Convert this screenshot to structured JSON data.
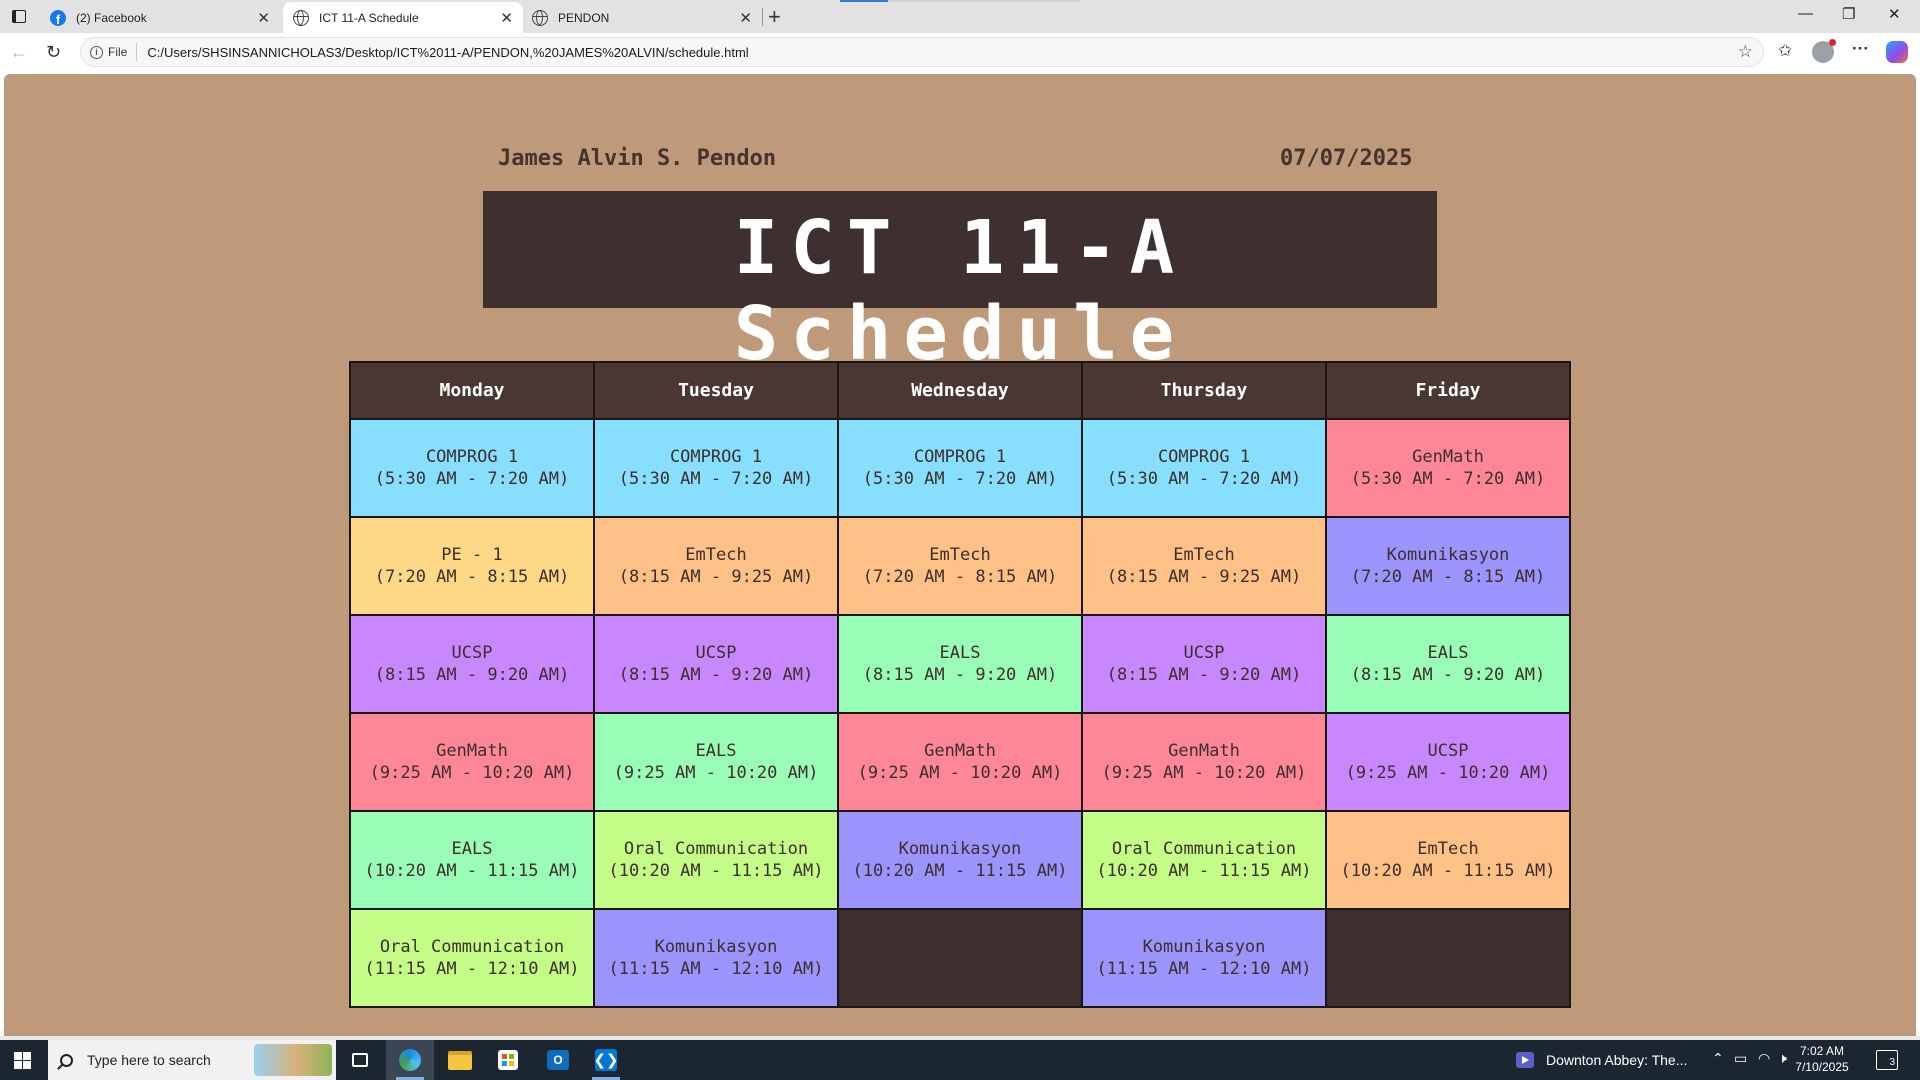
{
  "browser": {
    "tabs": [
      {
        "label": "(2) Facebook",
        "icon": "facebook-icon",
        "active": false
      },
      {
        "label": "ICT 11-A Schedule",
        "icon": "globe-icon",
        "active": true
      },
      {
        "label": "PENDON",
        "icon": "globe-icon",
        "active": false
      }
    ],
    "address": {
      "scheme_label": "File",
      "url": "C:/Users/SHSINSANNICHOLAS3/Desktop/ICT%2011-A/PENDON,%20JAMES%20ALVIN/schedule.html"
    }
  },
  "page": {
    "name": "James Alvin S. Pendon",
    "date": "07/07/2025",
    "title": "ICT 11-A Schedule",
    "colors": {
      "background": "#bf9a7a",
      "banner": "#3e3030",
      "header": "#4a3733",
      "COMPROG 1": "#87dffd",
      "GenMath": "#fd8796",
      "PE - 1": "#fdd987",
      "EmTech": "#fdc087",
      "Komunikasyon": "#9a94fc",
      "UCSP": "#c987fd",
      "EALS": "#9afdb7",
      "Oral Communication": "#c3fd87"
    },
    "days": [
      "Monday",
      "Tuesday",
      "Wednesday",
      "Thursday",
      "Friday"
    ],
    "rows": [
      [
        {
          "subject": "COMPROG 1",
          "time": "(5:30 AM - 7:20 AM)"
        },
        {
          "subject": "COMPROG 1",
          "time": "(5:30 AM - 7:20 AM)"
        },
        {
          "subject": "COMPROG 1",
          "time": "(5:30 AM - 7:20 AM)"
        },
        {
          "subject": "COMPROG 1",
          "time": "(5:30 AM - 7:20 AM)"
        },
        {
          "subject": "GenMath",
          "time": "(5:30 AM - 7:20 AM)"
        }
      ],
      [
        {
          "subject": "PE - 1",
          "time": "(7:20 AM - 8:15 AM)"
        },
        {
          "subject": "EmTech",
          "time": "(8:15 AM - 9:25 AM)"
        },
        {
          "subject": "EmTech",
          "time": "(7:20 AM - 8:15 AM)"
        },
        {
          "subject": "EmTech",
          "time": "(8:15 AM - 9:25 AM)"
        },
        {
          "subject": "Komunikasyon",
          "time": "(7:20 AM - 8:15 AM)"
        }
      ],
      [
        {
          "subject": "UCSP",
          "time": "(8:15 AM - 9:20 AM)"
        },
        {
          "subject": "UCSP",
          "time": "(8:15 AM - 9:20 AM)"
        },
        {
          "subject": "EALS",
          "time": "(8:15 AM - 9:20 AM)"
        },
        {
          "subject": "UCSP",
          "time": "(8:15 AM - 9:20 AM)"
        },
        {
          "subject": "EALS",
          "time": "(8:15 AM - 9:20 AM)"
        }
      ],
      [
        {
          "subject": "GenMath",
          "time": "(9:25 AM - 10:20 AM)"
        },
        {
          "subject": "EALS",
          "time": "(9:25 AM - 10:20 AM)"
        },
        {
          "subject": "GenMath",
          "time": "(9:25 AM - 10:20 AM)"
        },
        {
          "subject": "GenMath",
          "time": "(9:25 AM - 10:20 AM)"
        },
        {
          "subject": "UCSP",
          "time": "(9:25 AM - 10:20 AM)"
        }
      ],
      [
        {
          "subject": "EALS",
          "time": "(10:20 AM - 11:15 AM)"
        },
        {
          "subject": "Oral Communication",
          "time": "(10:20 AM - 11:15 AM)"
        },
        {
          "subject": "Komunikasyon",
          "time": "(10:20 AM - 11:15 AM)"
        },
        {
          "subject": "Oral Communication",
          "time": "(10:20 AM - 11:15 AM)"
        },
        {
          "subject": "EmTech",
          "time": "(10:20 AM - 11:15 AM)"
        }
      ],
      [
        {
          "subject": "Oral Communication",
          "time": "(11:15 AM - 12:10 AM)"
        },
        {
          "subject": "Komunikasyon",
          "time": "(11:15 AM - 12:10 AM)"
        },
        null,
        {
          "subject": "Komunikasyon",
          "time": "(11:15 AM - 12:10 AM)"
        },
        null
      ]
    ]
  },
  "taskbar": {
    "search_placeholder": "Type here to search",
    "media_title": "Downton Abbey: The...",
    "time": "7:02 AM",
    "date": "7/10/2025",
    "notification_count": "3"
  }
}
